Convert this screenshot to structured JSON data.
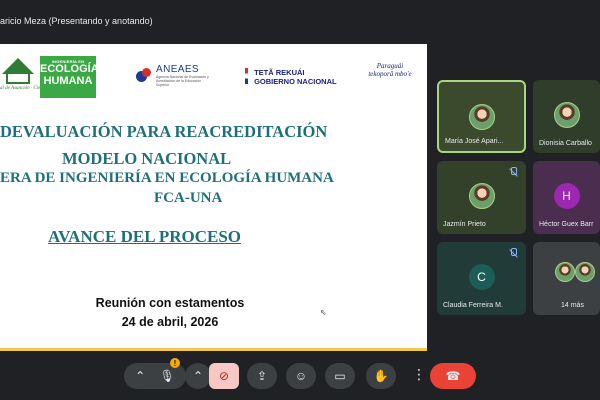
{
  "presenter": {
    "label": "aricio Meza (Presentando y anotando)"
  },
  "slide": {
    "logos": {
      "una_text": "al de Asunción · Ciencias Agrarias",
      "eco_small": "INGENIERÍA EN",
      "eco_line1": "ECOLOGÍA",
      "eco_line2": "HUMANA",
      "aneaes_name": "ANEAES",
      "aneaes_desc": "Agencia Nacional de Evaluación y Acreditación de la Educación Superior",
      "tekuai_line1": "TETÃ REKUÁI",
      "tekuai_line2": "GOBIERNO NACIONAL",
      "paraguay": "Paraguái tekoporã mbo'e"
    },
    "title_line1": "DEVALUACIÓN PARA REACREDITACIÓN",
    "title_line2": "MODELO NACIONAL",
    "title_line3": "ERA DE INGENIERÍA EN ECOLOGÍA HUMANA",
    "title_line4": "FCA-UNA",
    "subtitle": "AVANCE DEL PROCESO",
    "meeting_line1": "Reunión con estamentos",
    "meeting_line2": "24 de abril, 2026"
  },
  "participants": [
    {
      "name": "María José Apari...",
      "kind": "photo",
      "active": true
    },
    {
      "name": "Dionisia Carballo",
      "kind": "photo",
      "active": false
    },
    {
      "name": "Jazmín Prieto",
      "kind": "photo",
      "muted": true
    },
    {
      "name": "Héctor Guex Barr",
      "kind": "letter",
      "letter": "H",
      "color": "#9c27b0"
    },
    {
      "name": "Claudia Ferreira M.",
      "kind": "letter",
      "letter": "C",
      "color": "#1b5e57",
      "muted": true
    },
    {
      "name": "14 más",
      "kind": "group"
    }
  ],
  "controls": {
    "more_label": "⋮"
  },
  "colors": {
    "accent_active": "#a8d67c",
    "leave_red": "#ea4335",
    "slide_title": "#1f6f7a"
  }
}
